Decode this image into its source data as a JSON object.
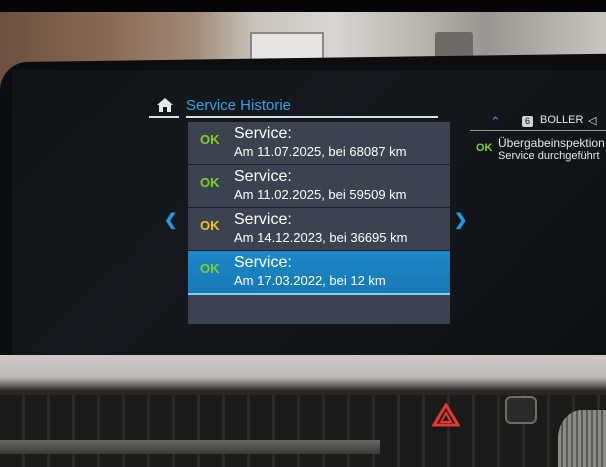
{
  "header": {
    "title": "Service Historie"
  },
  "service_list": [
    {
      "status": "OK",
      "status_color": "#7ed321",
      "title": "Service:",
      "detail": "Am 11.07.2025, bei 68087 km",
      "selected": false
    },
    {
      "status": "OK",
      "status_color": "#7ed321",
      "title": "Service:",
      "detail": "Am 11.02.2025, bei 59509 km",
      "selected": false
    },
    {
      "status": "OK",
      "status_color": "#f5c318",
      "title": "Service:",
      "detail": "Am 14.12.2023, bei 36695 km",
      "selected": false
    },
    {
      "status": "OK",
      "status_color": "#7ed321",
      "title": "Service:",
      "detail": "Am 17.03.2022, bei 12 km",
      "selected": true
    }
  ],
  "right_panel": {
    "preset_number": "6",
    "station": "BOLLER",
    "status": "OK",
    "title": "Übergabeinspektion",
    "detail": "Service durchgeführt"
  },
  "colors": {
    "accent": "#3aa0e6",
    "selected_row": "#1e88c8",
    "ok_green": "#7ed321",
    "ok_yellow": "#f5c318"
  },
  "icons": {
    "home": "home-icon",
    "left_arrow": "chevron-left-icon",
    "right_arrow": "chevron-right-icon",
    "hazard": "hazard-warning-icon"
  }
}
